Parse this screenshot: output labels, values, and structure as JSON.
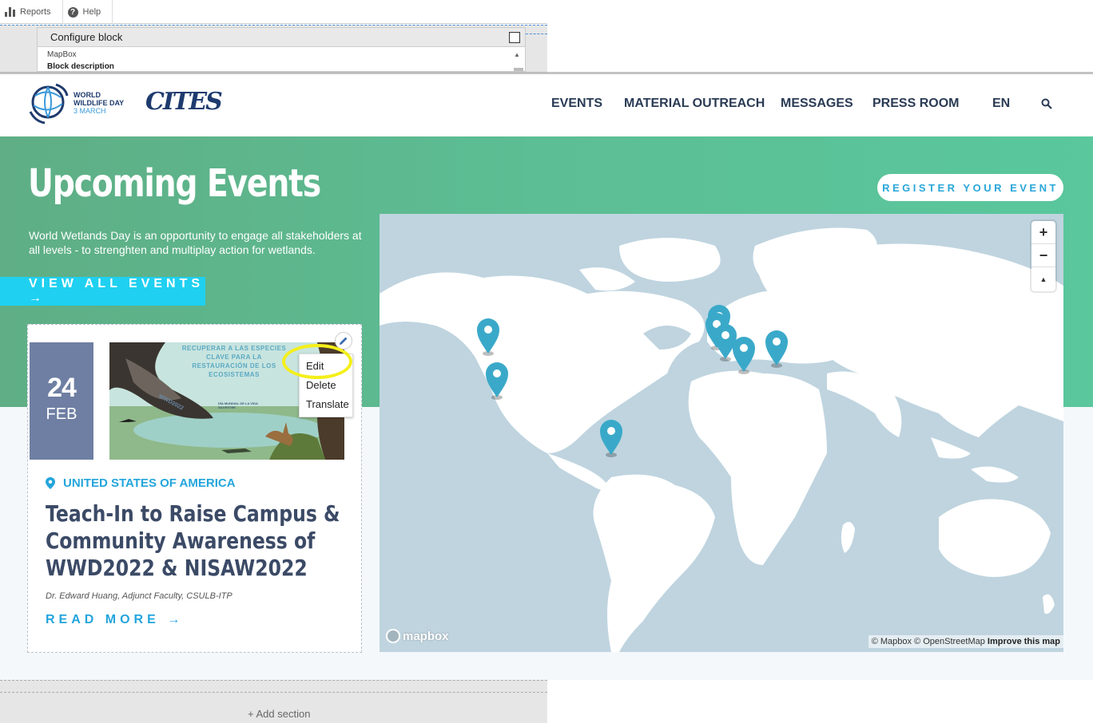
{
  "admin": {
    "reports_label": "Reports",
    "help_label": "Help",
    "config_title": "Configure block",
    "config_line1": "MapBox",
    "config_line2": "Block description",
    "add_section_label": "+ Add section"
  },
  "header": {
    "logo_line1": "WORLD",
    "logo_line2": "WILDLIFE DAY",
    "logo_line3": "3 MARCH",
    "partner_logo": "CITES",
    "nav": [
      "EVENTS",
      "MATERIAL OUTREACH",
      "MESSAGES",
      "PRESS ROOM",
      "EN"
    ]
  },
  "hero": {
    "title": "Upcoming Events",
    "text": "World Wetlands Day is an opportunity to engage all stakeholders at all levels - to strenghten and multiplay action for wetlands.",
    "view_all": "VIEW ALL EVENTS →",
    "register": "REGISTER YOUR EVENT"
  },
  "event": {
    "day": "24",
    "month": "FEB",
    "country": "UNITED STATES OF AMERICA",
    "title": "Teach-In to Raise Campus & Community Awareness of WWD2022 & NISAW2022",
    "author": "Dr. Edward Huang, Adjunct Faculty, CSULB-ITP",
    "read_more": "READ MORE →",
    "image_text": "RECUPERAR A LAS ESPECIES CLAVE PARA LA RESTAURACIÓN DE LOS ECOSISTEMAS",
    "image_tag": "WWD2022",
    "image_caption": "DÍA MUNDIAL DE LA VIDA SILVESTRE"
  },
  "context_menu": [
    "Edit",
    "Delete",
    "Translate"
  ],
  "map": {
    "zoom_in": "+",
    "zoom_out": "−",
    "compass": "▲",
    "logo": "mapbox",
    "attribution": "© Mapbox © OpenStreetMap",
    "improve": "Improve this map"
  },
  "colors": {
    "accent": "#23a5dc",
    "button_cyan": "#1fd0f0",
    "date_box": "#6f7fa3",
    "marker": "#3aa9c9"
  }
}
